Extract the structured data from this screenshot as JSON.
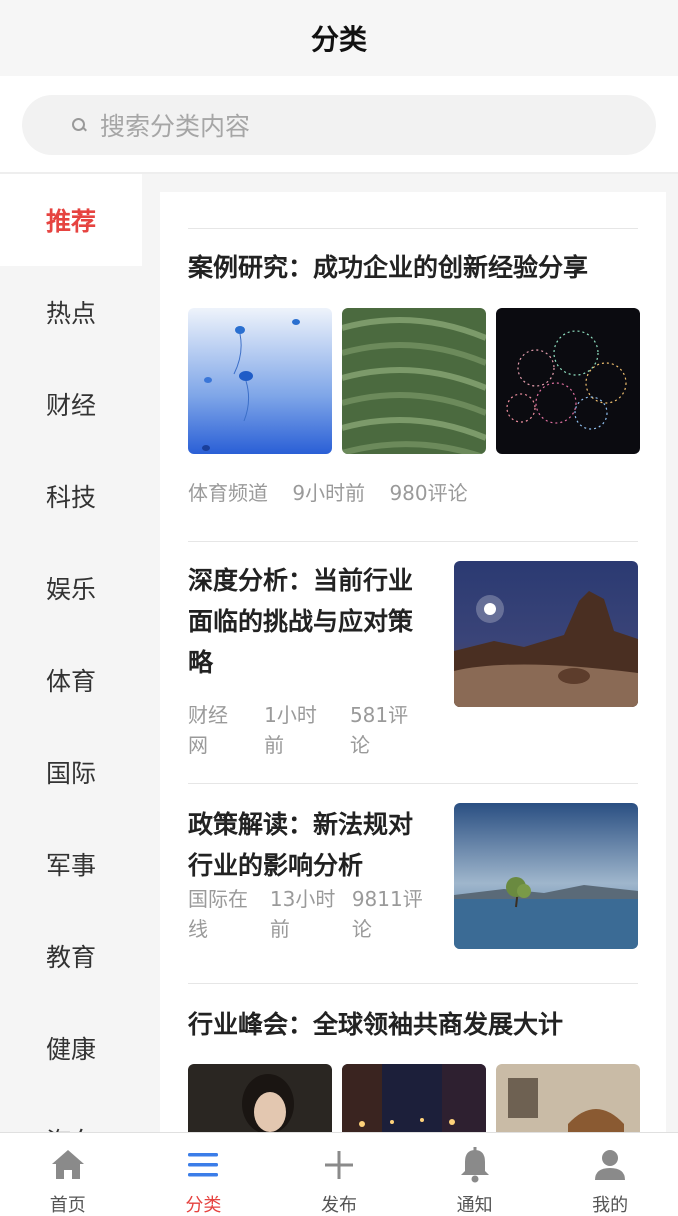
{
  "header": {
    "title": "分类"
  },
  "search": {
    "placeholder": "搜索分类内容"
  },
  "sidebar": {
    "items": [
      {
        "label": "推荐",
        "active": true
      },
      {
        "label": "热点"
      },
      {
        "label": "财经"
      },
      {
        "label": "科技"
      },
      {
        "label": "娱乐"
      },
      {
        "label": "体育"
      },
      {
        "label": "国际"
      },
      {
        "label": "军事"
      },
      {
        "label": "教育"
      },
      {
        "label": "健康"
      },
      {
        "label": "汽车"
      }
    ]
  },
  "articles": [
    {
      "title": "案例研究：成功企业的创新经验分享",
      "source": "体育频道",
      "time": "9小时前",
      "comments": "980评论"
    },
    {
      "title": "深度分析：当前行业面临的挑战与应对策略",
      "source_l1": "财经",
      "source_l2": "网",
      "time_l1": "1小时",
      "time_l2": "前",
      "comments_l1": "581评",
      "comments_l2": "论"
    },
    {
      "title": "政策解读：新法规对行业的影响分析",
      "source_l1": "国际在",
      "source_l2": "线",
      "time_l1": "13小时",
      "time_l2": "前",
      "comments_l1": "9811评",
      "comments_l2": "论"
    },
    {
      "title": "行业峰会：全球领袖共商发展大计"
    }
  ],
  "tabbar": {
    "items": [
      {
        "label": "首页",
        "icon": "home-icon"
      },
      {
        "label": "分类",
        "icon": "list-icon",
        "active": true
      },
      {
        "label": "发布",
        "icon": "plus-icon"
      },
      {
        "label": "通知",
        "icon": "bell-icon"
      },
      {
        "label": "我的",
        "icon": "user-icon"
      }
    ]
  },
  "colors": {
    "accent": "#e64340",
    "icon_active": "#3b7de8",
    "icon_inactive": "#8a8a8a"
  }
}
